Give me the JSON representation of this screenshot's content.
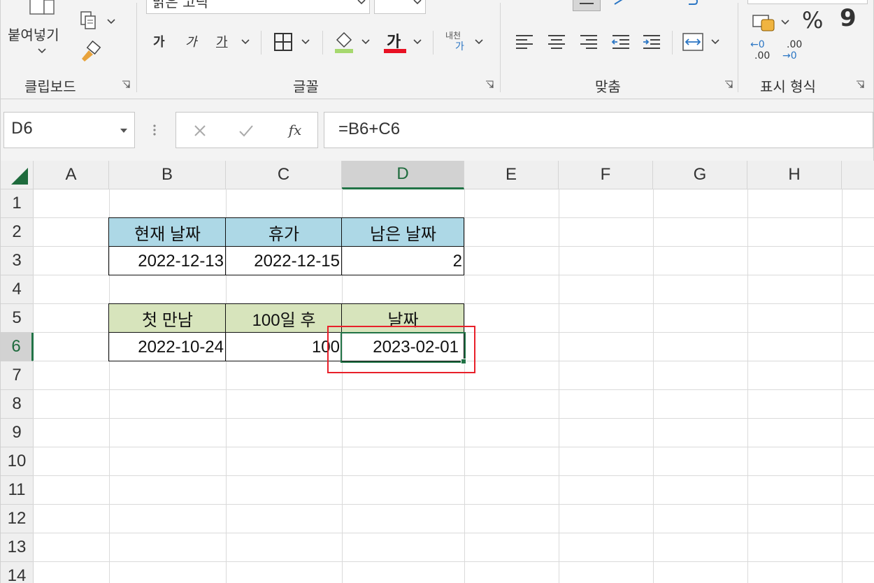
{
  "ribbon": {
    "clipboard": {
      "group_label": "클립보드",
      "paste_label": "붙여넣기"
    },
    "font": {
      "group_label": "글꼴",
      "font_name": "맑은 고딕",
      "grow_label": "가",
      "shrink_label": "가",
      "underline_label": "가",
      "font_color_label": "가",
      "font_color": "#e81123",
      "fill_color": "#a6d86e",
      "phonetic_top": "내천",
      "phonetic_bottom": "가"
    },
    "alignment": {
      "group_label": "맞춤"
    },
    "number": {
      "group_label": "표시 형식",
      "percent": "%",
      "comma": "9",
      "inc_a": "←0",
      "inc_b": ".00",
      "dec_a": ".00",
      "dec_b": "→0"
    }
  },
  "formula_bar": {
    "name_box": "D6",
    "fx_label": "fx",
    "formula": "=B6+C6"
  },
  "sheet": {
    "columns": [
      "A",
      "B",
      "C",
      "D",
      "E",
      "F",
      "G",
      "H"
    ],
    "rows": [
      "1",
      "2",
      "3",
      "4",
      "5",
      "6",
      "7",
      "8",
      "9",
      "10",
      "11",
      "12",
      "13",
      "14"
    ],
    "selected_cell": "D6",
    "table1": {
      "headers": [
        "현재 날짜",
        "휴가",
        "남은 날짜"
      ],
      "values": [
        "2022-12-13",
        "2022-12-15",
        "2"
      ],
      "header_color": "#add8e6"
    },
    "table2": {
      "headers": [
        "첫 만남",
        "100일 후",
        "날짜"
      ],
      "values": [
        "2022-10-24",
        "100",
        "2023-02-01"
      ],
      "header_color": "#d7e4bc"
    }
  },
  "colors": {
    "excel_green": "#217346",
    "highlight_red": "#e8202a"
  }
}
